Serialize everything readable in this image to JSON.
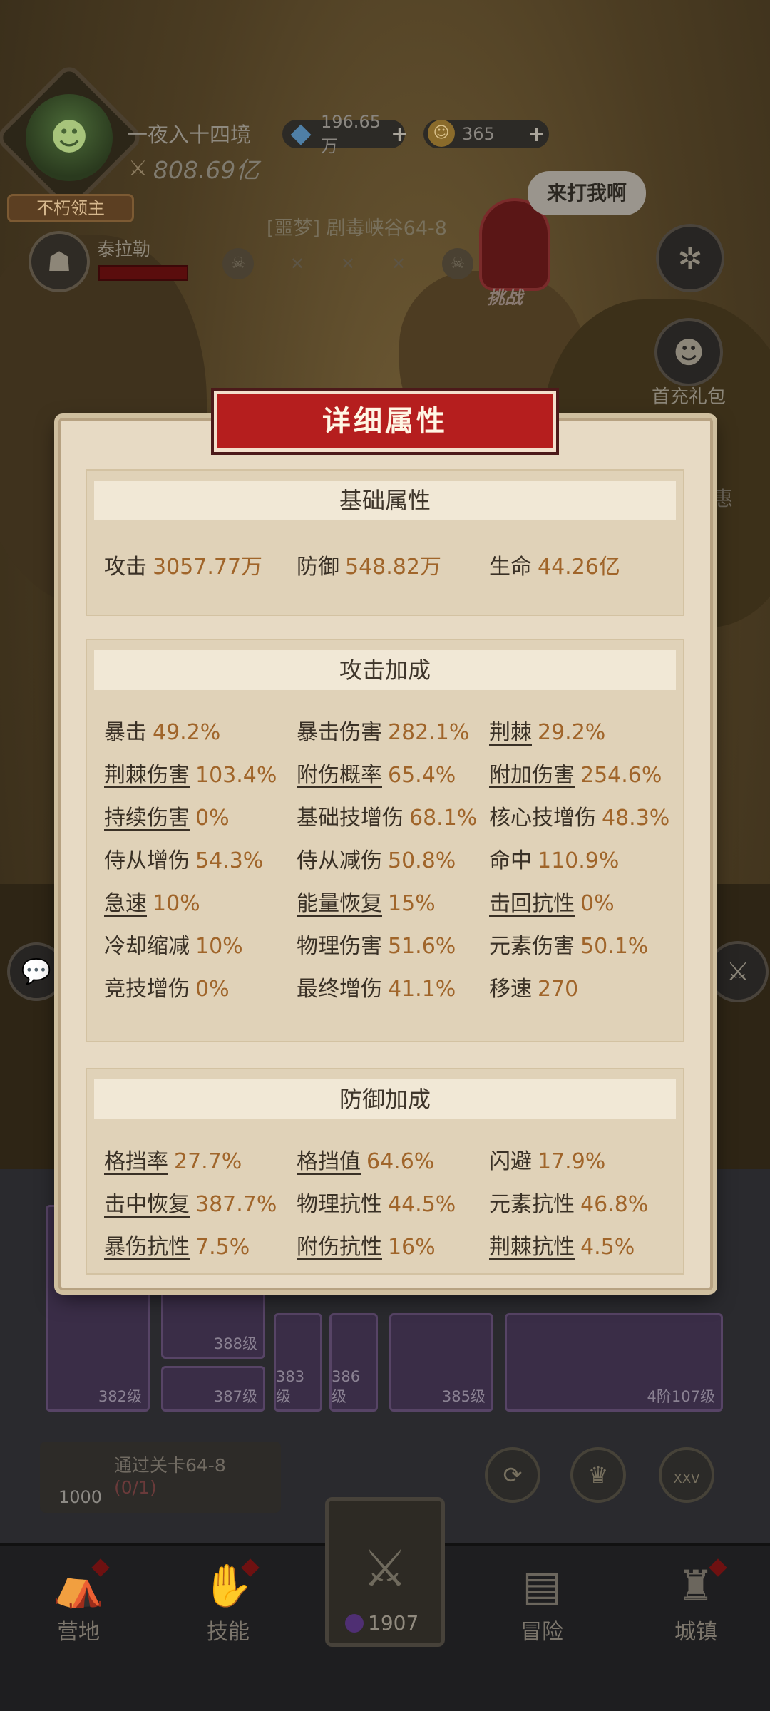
{
  "player": {
    "name": "一夜入十四境",
    "power": "808.69亿",
    "title": "不朽领主"
  },
  "resources": {
    "gems": "196.65万",
    "coins": "365"
  },
  "companion": {
    "name": "泰拉勒"
  },
  "stage": {
    "title": "[噩梦] 剧毒峡谷64-8",
    "challenge_label": "挑战",
    "speech": "来打我啊"
  },
  "side": {
    "gift_label": "首充礼包",
    "edge_text": "惠"
  },
  "modal": {
    "title": "详细属性",
    "sections": [
      {
        "title": "基础属性",
        "attrs": [
          {
            "label": "攻击",
            "value": "3057.77万",
            "underline": false
          },
          {
            "label": "防御",
            "value": "548.82万",
            "underline": false
          },
          {
            "label": "生命",
            "value": "44.26亿",
            "underline": false
          }
        ]
      },
      {
        "title": "攻击加成",
        "attrs": [
          {
            "label": "暴击",
            "value": "49.2%",
            "underline": false
          },
          {
            "label": "暴击伤害",
            "value": "282.1%",
            "underline": false
          },
          {
            "label": "荆棘",
            "value": "29.2%",
            "underline": true
          },
          {
            "label": "荆棘伤害",
            "value": "103.4%",
            "underline": true
          },
          {
            "label": "附伤概率",
            "value": "65.4%",
            "underline": true
          },
          {
            "label": "附加伤害",
            "value": "254.6%",
            "underline": true
          },
          {
            "label": "持续伤害",
            "value": "0%",
            "underline": true
          },
          {
            "label": "基础技增伤",
            "value": "68.1%",
            "underline": false
          },
          {
            "label": "核心技增伤",
            "value": "48.3%",
            "underline": false
          },
          {
            "label": "侍从增伤",
            "value": "54.3%",
            "underline": false
          },
          {
            "label": "侍从减伤",
            "value": "50.8%",
            "underline": false
          },
          {
            "label": "命中",
            "value": "110.9%",
            "underline": false
          },
          {
            "label": "急速",
            "value": "10%",
            "underline": true
          },
          {
            "label": "能量恢复",
            "value": "15%",
            "underline": true
          },
          {
            "label": "击回抗性",
            "value": "0%",
            "underline": true
          },
          {
            "label": "冷却缩减",
            "value": "10%",
            "underline": false
          },
          {
            "label": "物理伤害",
            "value": "51.6%",
            "underline": false
          },
          {
            "label": "元素伤害",
            "value": "50.1%",
            "underline": false
          },
          {
            "label": "竞技增伤",
            "value": "0%",
            "underline": false
          },
          {
            "label": "最终增伤",
            "value": "41.1%",
            "underline": false
          },
          {
            "label": "移速",
            "value": "270",
            "underline": false
          }
        ]
      },
      {
        "title": "防御加成",
        "attrs": [
          {
            "label": "格挡率",
            "value": "27.7%",
            "underline": true
          },
          {
            "label": "格挡值",
            "value": "64.6%",
            "underline": true
          },
          {
            "label": "闪避",
            "value": "17.9%",
            "underline": false
          },
          {
            "label": "击中恢复",
            "value": "387.7%",
            "underline": true
          },
          {
            "label": "物理抗性",
            "value": "44.5%",
            "underline": false
          },
          {
            "label": "元素抗性",
            "value": "46.8%",
            "underline": false
          },
          {
            "label": "暴伤抗性",
            "value": "7.5%",
            "underline": true
          },
          {
            "label": "附伤抗性",
            "value": "16%",
            "underline": true
          },
          {
            "label": "荆棘抗性",
            "value": "4.5%",
            "underline": true
          }
        ]
      }
    ]
  },
  "equipment": {
    "levels": [
      "382级",
      "388级",
      "387级",
      "383级",
      "386级",
      "385级",
      "4阶107级"
    ]
  },
  "quest": {
    "text": "通过关卡64-8",
    "progress": "(0/1)",
    "reward": "1000"
  },
  "round_buttons": {
    "rank": "XXV"
  },
  "energy": "1907",
  "nav": {
    "camp": "营地",
    "skills": "技能",
    "adventure": "冒险",
    "town": "城镇"
  },
  "colors": {
    "modal_bg": "#e7dac4",
    "header_red": "#b51e1e",
    "value_brown": "#a0652a"
  }
}
